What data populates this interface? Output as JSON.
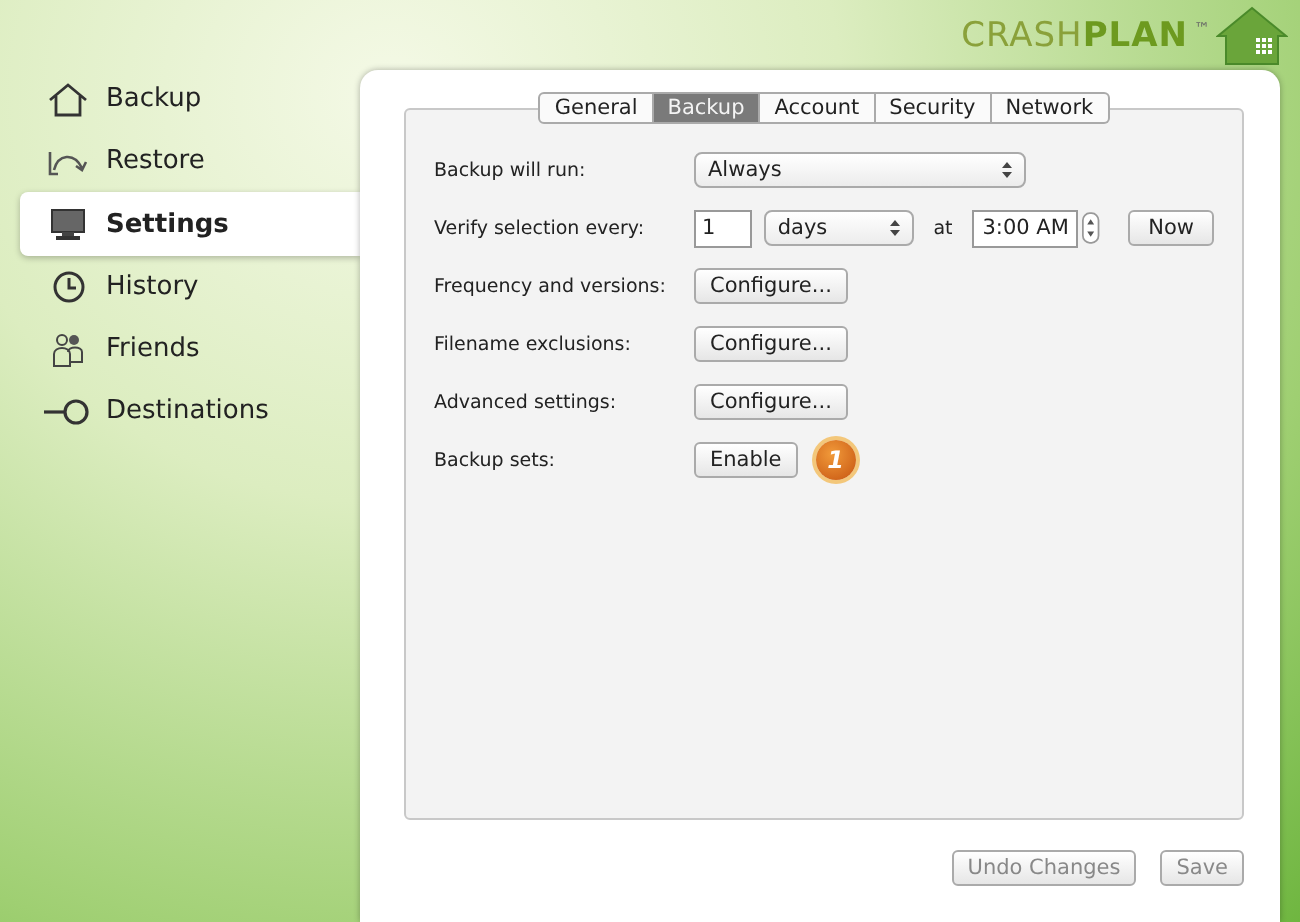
{
  "logo": {
    "text": "CRASH**PLAN**",
    "trademark": "™"
  },
  "sidebar": {
    "items": [
      {
        "label": "Backup",
        "kind": "house",
        "selected": false
      },
      {
        "label": "Restore",
        "kind": "restore",
        "selected": false
      },
      {
        "label": "Settings",
        "kind": "monitor",
        "selected": true
      },
      {
        "label": "History",
        "kind": "clock",
        "selected": false
      },
      {
        "label": "Friends",
        "kind": "people",
        "selected": false
      },
      {
        "label": "Destinations",
        "kind": "destination",
        "selected": false
      }
    ]
  },
  "tabs": [
    {
      "label": "General",
      "selected": false
    },
    {
      "label": "Backup",
      "selected": true
    },
    {
      "label": "Account",
      "selected": false
    },
    {
      "label": "Security",
      "selected": false
    },
    {
      "label": "Network",
      "selected": false
    }
  ],
  "settings": [
    {
      "kind": "select",
      "label": "Backup will run:",
      "value": "Always"
    },
    {
      "kind": "verify",
      "label": "Verify selection every:",
      "count": "1",
      "unit": "days",
      "at": "at",
      "time": "3:00 AM",
      "button": "Now"
    },
    {
      "kind": "button",
      "label": "Frequency and versions:",
      "button": "Configure..."
    },
    {
      "kind": "button",
      "label": "Filename exclusions:",
      "button": "Configure..."
    },
    {
      "kind": "button",
      "label": "Advanced settings:",
      "button": "Configure..."
    },
    {
      "kind": "button",
      "label": "Backup sets:",
      "button": "Enable",
      "badge": "1"
    }
  ],
  "footer_buttons": [
    {
      "label": "Undo Changes",
      "disabled": true
    },
    {
      "label": "Save",
      "disabled": true
    }
  ]
}
